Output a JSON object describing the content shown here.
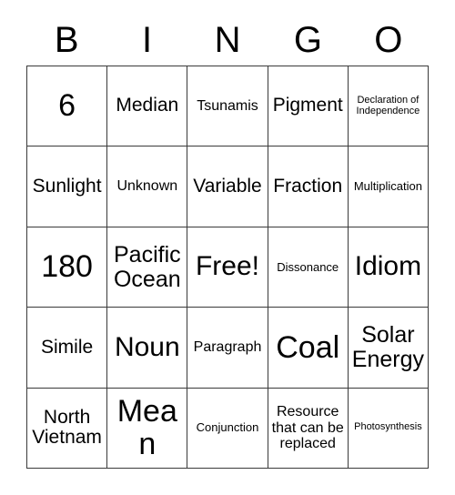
{
  "card": {
    "header_letters": [
      "B",
      "I",
      "N",
      "G",
      "O"
    ],
    "rows": [
      [
        {
          "text": "6"
        },
        {
          "text": "Median"
        },
        {
          "text": "Tsunamis"
        },
        {
          "text": "Pigment"
        },
        {
          "text": "Declaration of Independence"
        }
      ],
      [
        {
          "text": "Sunlight"
        },
        {
          "text": "Unknown"
        },
        {
          "text": "Variable"
        },
        {
          "text": "Fraction"
        },
        {
          "text": "Multiplication"
        }
      ],
      [
        {
          "text": "180"
        },
        {
          "text": "Pacific Ocean"
        },
        {
          "text": "Free!"
        },
        {
          "text": "Dissonance"
        },
        {
          "text": "Idiom"
        }
      ],
      [
        {
          "text": "Simile"
        },
        {
          "text": "Noun"
        },
        {
          "text": "Paragraph"
        },
        {
          "text": "Coal"
        },
        {
          "text": "Solar Energy"
        }
      ],
      [
        {
          "text": "North Vietnam"
        },
        {
          "text": "Mean"
        },
        {
          "text": "Conjunction"
        },
        {
          "text": "Resource that can be replaced"
        },
        {
          "text": "Photosynthesis"
        }
      ]
    ]
  },
  "colors": {
    "background": "#ffffff",
    "grid_line": "#3a3a3a",
    "text": "#000000"
  }
}
